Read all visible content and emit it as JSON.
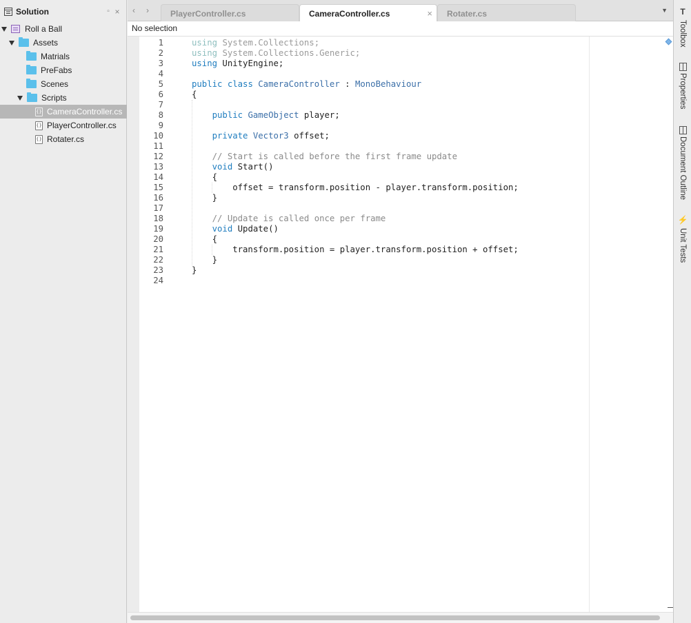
{
  "solution": {
    "title": "Solution",
    "items": [
      {
        "label": "Roll a Ball",
        "kind": "project",
        "expanded": true
      },
      {
        "label": "Assets",
        "kind": "folder",
        "expanded": true
      },
      {
        "label": "Matrials",
        "kind": "folder"
      },
      {
        "label": "PreFabs",
        "kind": "folder"
      },
      {
        "label": "Scenes",
        "kind": "folder"
      },
      {
        "label": "Scripts",
        "kind": "folder",
        "expanded": true
      },
      {
        "label": "CameraController.cs",
        "kind": "file",
        "selected": true
      },
      {
        "label": "PlayerController.cs",
        "kind": "file"
      },
      {
        "label": "Rotater.cs",
        "kind": "file"
      }
    ]
  },
  "tabs": [
    {
      "label": "PlayerController.cs",
      "active": false
    },
    {
      "label": "CameraController.cs",
      "active": true
    },
    {
      "label": "Rotater.cs",
      "active": false
    }
  ],
  "pathbar": {
    "text": "No selection"
  },
  "editor": {
    "lines": [
      "using System.Collections;",
      "using System.Collections.Generic;",
      "using UnityEngine;",
      "",
      "public class CameraController : MonoBehaviour",
      "{",
      "",
      "    public GameObject player;",
      "",
      "    private Vector3 offset;",
      "",
      "    // Start is called before the first frame update",
      "    void Start()",
      "    {",
      "        offset = transform.position - player.transform.position;",
      "    }",
      "",
      "    // Update is called once per frame",
      "    void Update()",
      "    {",
      "        transform.position = player.transform.position + offset;",
      "    }",
      "}",
      ""
    ],
    "line_numbers": [
      "1",
      "2",
      "3",
      "4",
      "5",
      "6",
      "7",
      "8",
      "9",
      "10",
      "11",
      "12",
      "13",
      "14",
      "15",
      "16",
      "17",
      "18",
      "19",
      "20",
      "21",
      "22",
      "23",
      "24"
    ]
  },
  "right_panels": [
    {
      "label": "Toolbox",
      "icon": "toolbox-icon"
    },
    {
      "label": "Properties",
      "icon": "properties-icon"
    },
    {
      "label": "Document Outline",
      "icon": "document-outline-icon"
    },
    {
      "label": "Unit Tests",
      "icon": "unit-tests-icon"
    }
  ],
  "colors": {
    "keyword": "#1f7dbf",
    "type": "#3b6fa8",
    "comment": "#8a8a8a",
    "folder": "#5bc0eb",
    "selection": "#b7b7b7"
  }
}
